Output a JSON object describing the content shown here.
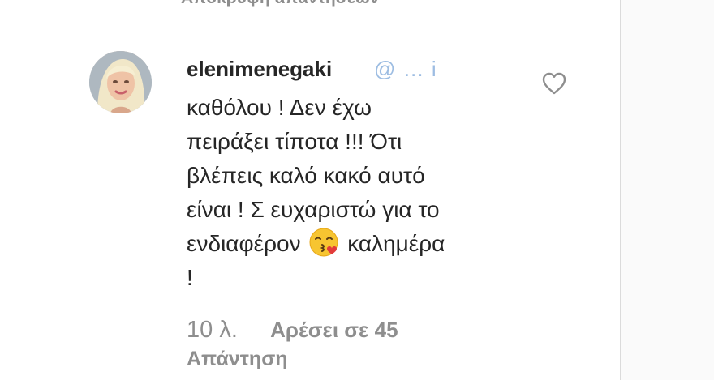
{
  "top": {
    "hidden_replies_label": "Απόκρυψη απαντήσεων"
  },
  "comment": {
    "username": "elenimenegaki",
    "mention": "@ … i",
    "lines": [
      "καθόλου ! Δεν έχω",
      "πειράξει τίποτα !!! Ότι",
      "βλέπεις καλό κακό αυτό",
      "είναι ! Σ ευχαριστώ για το",
      "ενδιαφέρον",
      "καλημέρα",
      "!"
    ],
    "time": "10 λ.",
    "likes": "Αρέσει σε 45",
    "reply_label": "Απάντηση"
  },
  "icons": {
    "like": "heart-outline-icon",
    "emoji": "kissing-face-emoji-icon",
    "avatar": "profile-photo"
  },
  "colors": {
    "text": "#262626",
    "secondary": "#8e8e8e",
    "mention": "#7da7d9",
    "panel": "#fafafa",
    "border": "#dbdbdb"
  }
}
